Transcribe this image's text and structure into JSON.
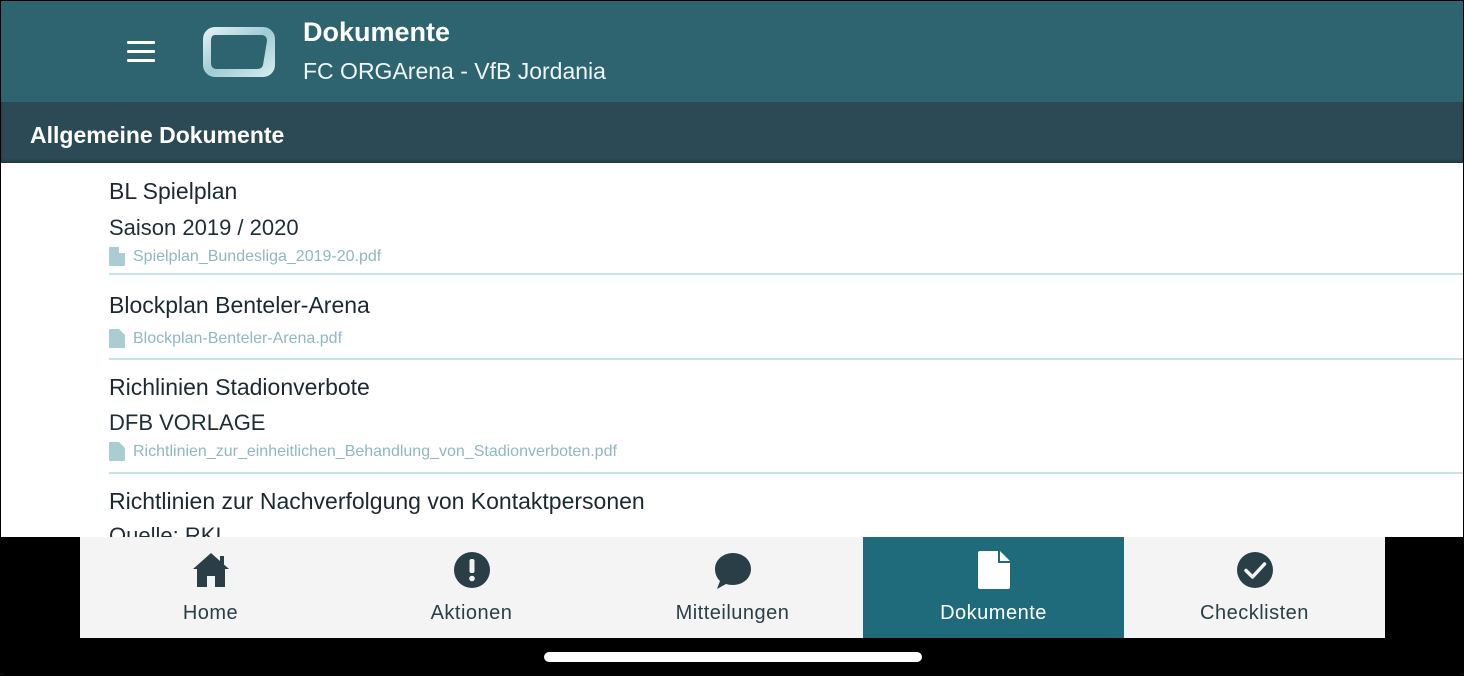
{
  "appbar": {
    "title": "Dokumente",
    "subtitle": "FC ORGArena - VfB Jordania",
    "menu_icon": "hamburger-menu-icon",
    "logo_icon": "app-logo"
  },
  "section": {
    "title": "Allgemeine Dokumente"
  },
  "documents": [
    {
      "title": "BL Spielplan",
      "subtitle": "Saison 2019 / 2020",
      "file": "Spielplan_Bundesliga_2019-20.pdf"
    },
    {
      "title": "Blockplan Benteler-Arena",
      "subtitle": "",
      "file": "Blockplan-Benteler-Arena.pdf"
    },
    {
      "title": "Richlinien Stadionverbote",
      "subtitle": "DFB VORLAGE",
      "file": "Richtlinien_zur_einheitlichen_Behandlung_von_Stadionverboten.pdf"
    },
    {
      "title": "Richtlinien zur Nachverfolgung von Kontaktpersonen",
      "subtitle": "Quelle: RKI",
      "file": ""
    }
  ],
  "tabs": [
    {
      "label": "Home",
      "icon": "home-icon",
      "active": false
    },
    {
      "label": "Aktionen",
      "icon": "exclamation-circle-icon",
      "active": false
    },
    {
      "label": "Mitteilungen",
      "icon": "chat-bubble-icon",
      "active": false
    },
    {
      "label": "Dokumente",
      "icon": "document-icon",
      "active": true
    },
    {
      "label": "Checklisten",
      "icon": "check-circle-icon",
      "active": false
    }
  ],
  "colors": {
    "appbar": "#2d6470",
    "section_header": "#2c4a55",
    "active_tab": "#1f6b7b",
    "divider": "#c6e6e3",
    "file_text": "#8fb8bf"
  }
}
